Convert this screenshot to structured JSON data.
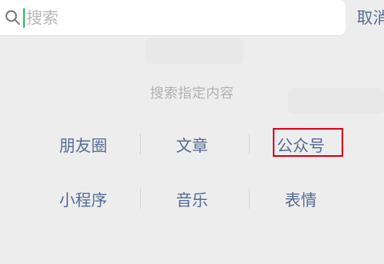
{
  "search": {
    "placeholder": "搜索",
    "cancel_label": "取消"
  },
  "section": {
    "title": "搜索指定内容"
  },
  "categories": [
    {
      "label": "朋友圈"
    },
    {
      "label": "文章"
    },
    {
      "label": "公众号"
    },
    {
      "label": "小程序"
    },
    {
      "label": "音乐"
    },
    {
      "label": "表情"
    }
  ],
  "colors": {
    "accent_link": "#576b95",
    "cursor": "#2bbd62",
    "highlight": "#d9001b"
  }
}
